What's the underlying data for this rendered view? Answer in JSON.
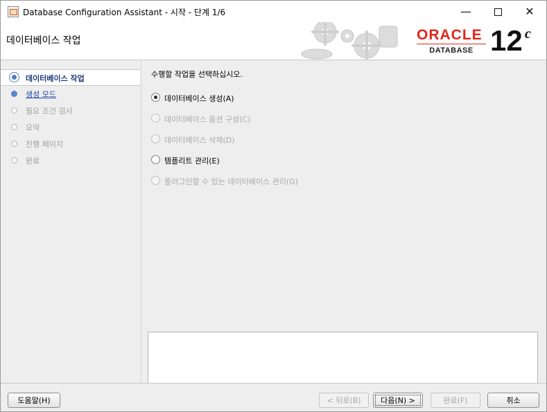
{
  "window": {
    "title": "Database Configuration Assistant - 시작 - 단계 1/6",
    "minimize_glyph": "—",
    "close_glyph": "✕"
  },
  "banner": {
    "title": "데이터베이스 작업",
    "logo_brand": "ORACLE",
    "logo_sub": "DATABASE",
    "version": "12",
    "version_suffix": "c"
  },
  "sidebar": {
    "steps": [
      {
        "label": "데이터베이스 작업",
        "state": "active"
      },
      {
        "label": "생성 모드",
        "state": "link"
      },
      {
        "label": "필요 조건 검사",
        "state": "disabled"
      },
      {
        "label": "요약",
        "state": "disabled"
      },
      {
        "label": "진행 페이지",
        "state": "disabled"
      },
      {
        "label": "완료",
        "state": "disabled"
      }
    ]
  },
  "main": {
    "prompt": "수행할 작업을 선택하십시오.",
    "options": [
      {
        "label": "데이터베이스 생성(A)",
        "selected": true,
        "enabled": true
      },
      {
        "label": "데이터베이스 옵션 구성(C)",
        "selected": false,
        "enabled": false
      },
      {
        "label": "데이터베이스 삭제(D)",
        "selected": false,
        "enabled": false
      },
      {
        "label": "템플리트 관리(E)",
        "selected": false,
        "enabled": true
      },
      {
        "label": "플러그인할 수 있는 데이터베이스 관리(G)",
        "selected": false,
        "enabled": false
      }
    ]
  },
  "footer": {
    "help_label": "도움말(H)",
    "back_label": "< 뒤로(B)",
    "next_label": "다음(N) >",
    "finish_label": "완료(F)",
    "cancel_label": "취소"
  },
  "colors": {
    "oracle_red": "#e0261b",
    "active_step_text": "#1f3c7a",
    "link_text": "#1c43a8"
  }
}
